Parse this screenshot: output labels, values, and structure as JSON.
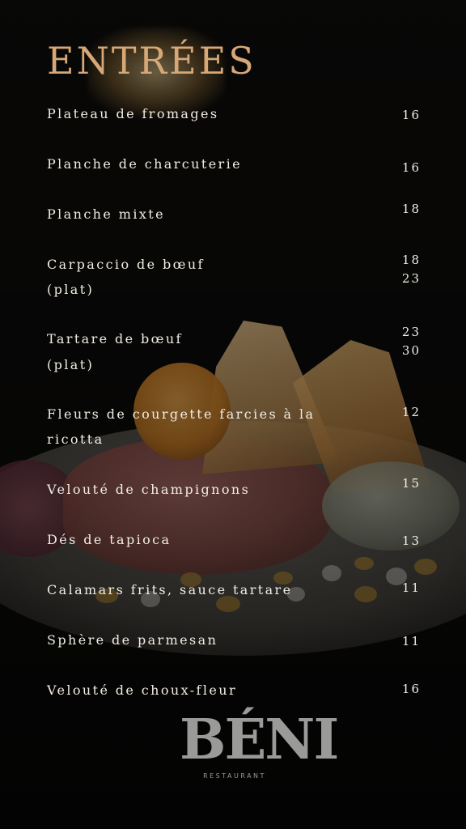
{
  "title": "ENTRÉES",
  "items": [
    {
      "name": "Plateau de fromages",
      "prices": [
        "16"
      ]
    },
    {
      "name": "Planche de charcuterie",
      "prices": [
        "16"
      ]
    },
    {
      "name": "Planche mixte",
      "prices": [
        "18"
      ]
    },
    {
      "name": "Carpaccio de bœuf",
      "sub": "(plat)",
      "prices": [
        "18",
        "23"
      ]
    },
    {
      "name": "Tartare de bœuf",
      "sub": "(plat)",
      "prices": [
        "23",
        "30"
      ]
    },
    {
      "name": "Fleurs de courgette farcies à la",
      "sub": "ricotta",
      "prices": [
        "12"
      ]
    },
    {
      "name": "Velouté de champignons",
      "prices": [
        "15"
      ]
    },
    {
      "name": "Dés de tapioca",
      "prices": [
        "13"
      ]
    },
    {
      "name": "Calamars frits, sauce tartare",
      "prices": [
        "11"
      ]
    },
    {
      "name": "Sphère de parmesan",
      "prices": [
        "11"
      ]
    },
    {
      "name": "Velouté de choux-fleur",
      "prices": [
        "16"
      ]
    }
  ],
  "logo": {
    "wordmark": "BÉNI",
    "tagline": "RESTAURANT"
  },
  "colors": {
    "title": "#d6a878",
    "text": "#f2ede4",
    "logo": "#9a9a98",
    "background": "#0b0a09"
  }
}
